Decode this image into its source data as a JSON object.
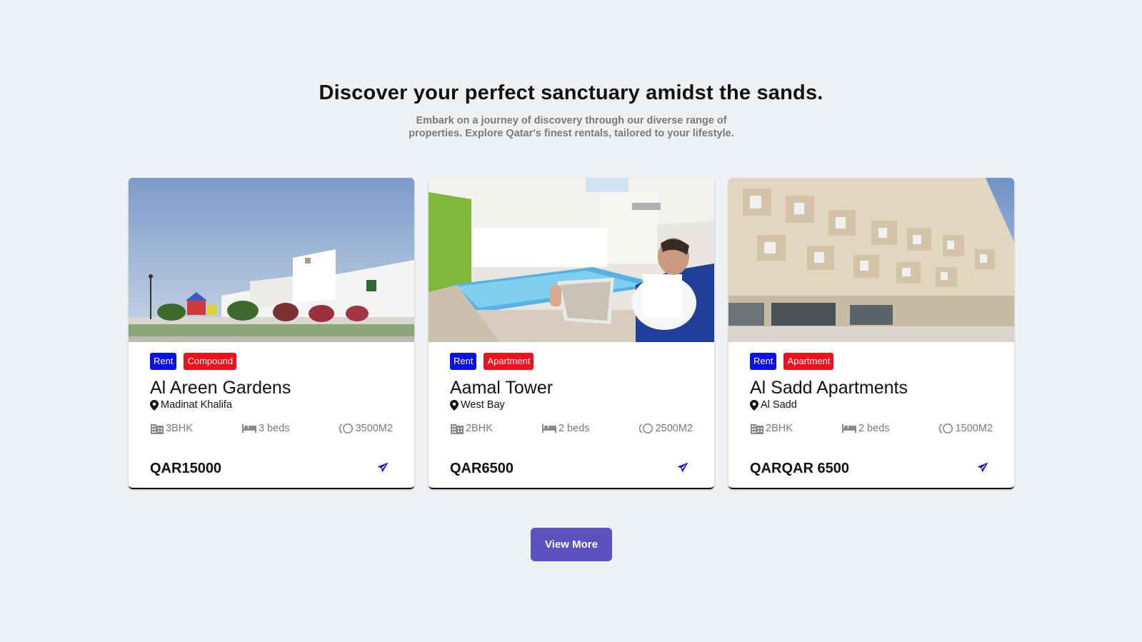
{
  "section": {
    "title": "Discover your perfect sanctuary amidst the sands.",
    "subtitle": "Embark on a journey of discovery through our diverse range of properties. Explore Qatar's finest rentals, tailored to your lifestyle."
  },
  "colors": {
    "background": "#eef1f4",
    "tag_rent": "#0a12e8",
    "tag_type": "#f0101b",
    "send_icon": "#1b12d6",
    "view_more_button": "#5a52c0"
  },
  "icons": {
    "location": "map-pin-icon",
    "type": "building-icon",
    "beds": "bed-icon",
    "area": "area-icon",
    "enquire": "send-icon"
  },
  "cards": [
    {
      "tag_listing": "Rent",
      "tag_type": "Compound",
      "title": "Al Areen Gardens",
      "location": "Madinat Khalifa",
      "bhk": "3BHK",
      "beds": "3 beds",
      "area": "3500M2",
      "price": "QAR15000",
      "image": "compound-villas-photo"
    },
    {
      "tag_listing": "Rent",
      "tag_type": "Apartment",
      "title": "Aamal Tower",
      "location": "West Bay",
      "bhk": "2BHK",
      "beds": "2 beds",
      "area": "2500M2",
      "price": "QAR6500",
      "image": "pool-lounge-photo"
    },
    {
      "tag_listing": "Rent",
      "tag_type": "Apartment",
      "title": "Al Sadd Apartments",
      "location": "Al Sadd",
      "bhk": "2BHK",
      "beds": "2 beds",
      "area": "1500M2",
      "price": "QARQAR 6500",
      "image": "apartment-building-photo"
    }
  ],
  "actions": {
    "view_more": "View More"
  }
}
